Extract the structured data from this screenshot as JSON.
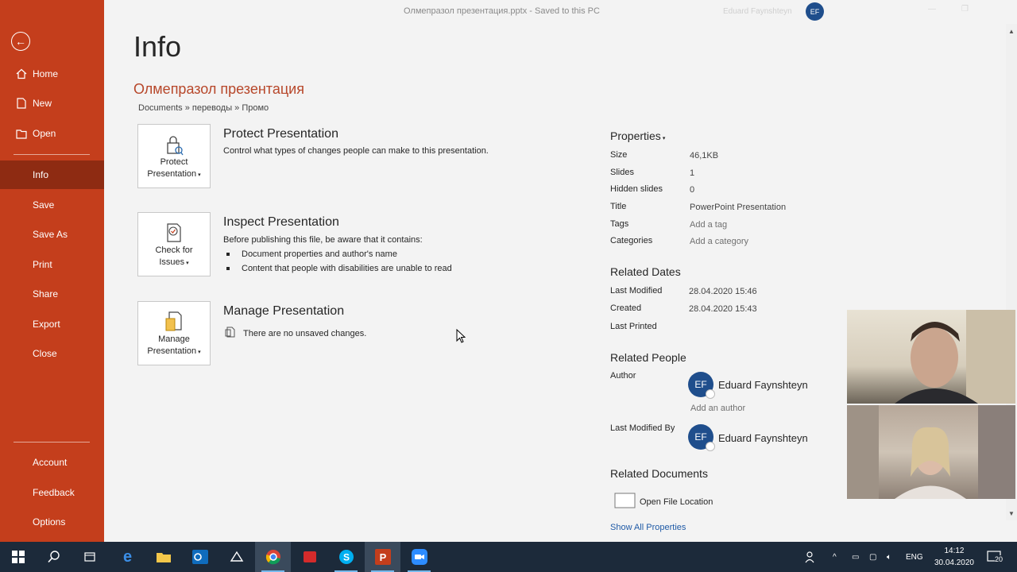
{
  "window": {
    "title": "Олмепразол презентация.pptx  -  Saved to this PC",
    "user_name": "Eduard Faynshteyn",
    "user_initials": "EF"
  },
  "sidebar": {
    "items": [
      {
        "label": "Home",
        "icon": "home-icon"
      },
      {
        "label": "New",
        "icon": "new-icon"
      },
      {
        "label": "Open",
        "icon": "folder-open-icon"
      },
      {
        "label": "Info",
        "active": true
      },
      {
        "label": "Save"
      },
      {
        "label": "Save As"
      },
      {
        "label": "Print"
      },
      {
        "label": "Share"
      },
      {
        "label": "Export"
      },
      {
        "label": "Close"
      }
    ],
    "bottom_items": [
      {
        "label": "Account"
      },
      {
        "label": "Feedback"
      },
      {
        "label": "Options"
      }
    ]
  },
  "main": {
    "page_title": "Info",
    "doc_title": "Олмепразол презентация",
    "breadcrumb": "Documents » переводы » Промо",
    "sections": [
      {
        "tile_label_1": "Protect",
        "tile_label_2": "Presentation",
        "title": "Protect Presentation",
        "desc": "Control what types of changes people can make to this presentation."
      },
      {
        "tile_label_1": "Check for",
        "tile_label_2": "Issues",
        "title": "Inspect Presentation",
        "desc": "Before publishing this file, be aware that it contains:",
        "bullets": [
          "Document properties and author's name",
          "Content that people with disabilities are unable to read"
        ]
      },
      {
        "tile_label_1": "Manage",
        "tile_label_2": "Presentation",
        "title": "Manage Presentation",
        "desc": "There are no unsaved changes."
      }
    ]
  },
  "properties": {
    "heading": "Properties",
    "rows": [
      {
        "label": "Size",
        "value": "46,1KB"
      },
      {
        "label": "Slides",
        "value": "1"
      },
      {
        "label": "Hidden slides",
        "value": "0"
      },
      {
        "label": "Title",
        "value": "PowerPoint Presentation"
      },
      {
        "label": "Tags",
        "value": "Add a tag"
      },
      {
        "label": "Categories",
        "value": "Add a category"
      }
    ],
    "related_dates_heading": "Related Dates",
    "dates": [
      {
        "label": "Last Modified",
        "value": "28.04.2020 15:46"
      },
      {
        "label": "Created",
        "value": "28.04.2020 15:43"
      },
      {
        "label": "Last Printed",
        "value": ""
      }
    ],
    "related_people_heading": "Related People",
    "author_label": "Author",
    "author_name": "Eduard Faynshteyn",
    "author_initials": "EF",
    "add_author": "Add an author",
    "last_modified_by_label": "Last Modified By",
    "last_modified_by_name": "Eduard Faynshteyn",
    "last_modified_by_initials": "EF",
    "related_documents_heading": "Related Documents",
    "open_file_location": "Open File Location",
    "show_all": "Show All Properties"
  },
  "taskbar": {
    "icons": [
      "windows-start-icon",
      "search-icon",
      "task-view-icon",
      "edge-icon",
      "file-explorer-icon",
      "outlook-icon",
      "app-icon",
      "chrome-icon",
      "app-red-icon",
      "skype-icon",
      "powerpoint-icon",
      "zoom-icon"
    ],
    "language": "ENG",
    "time": "14:12",
    "date": "30.04.2020",
    "notification_count": "20"
  },
  "colors": {
    "sidebar": "#c43e1c",
    "sidebar_active": "#8e2b12",
    "accent_text": "#b7472a",
    "badge": "#1f4e8c",
    "link": "#1f5aa6"
  }
}
